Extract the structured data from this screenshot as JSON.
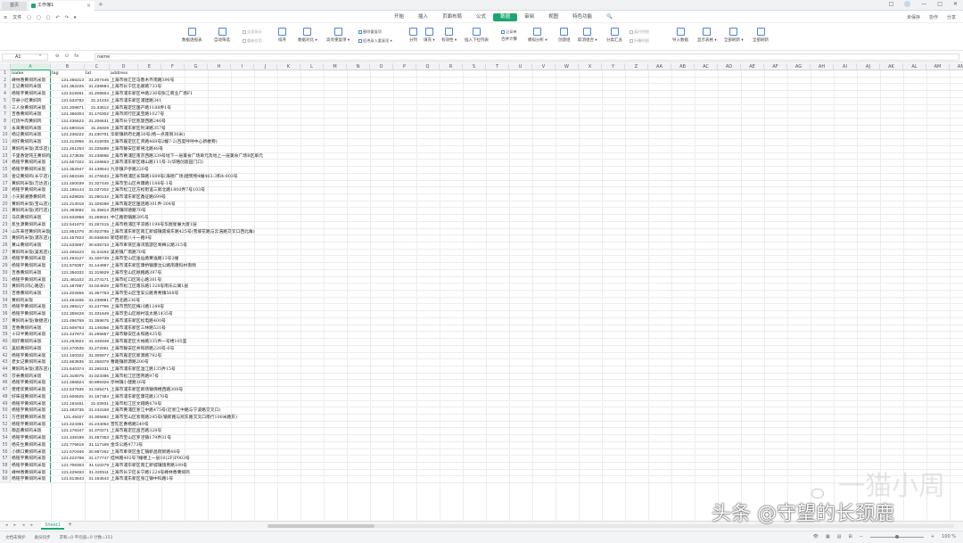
{
  "titlebar": {
    "home_tab": "首页",
    "doc_tab": "工作簿1",
    "add_tab": "+",
    "win_controls": [
      "□",
      "—",
      "□",
      "✕"
    ]
  },
  "menubar": {
    "file": "文件",
    "quick_icons": [
      "▢",
      "▢",
      "▢",
      "↶",
      "↷",
      "▾"
    ],
    "tabs": [
      "开始",
      "插入",
      "页面布局",
      "公式",
      "数据",
      "审阅",
      "视图",
      "特色功能"
    ],
    "active_tab": "数据",
    "search": "🔍",
    "right_items": [
      "未保存",
      "协作",
      "分享"
    ]
  },
  "ribbon": {
    "buttons": [
      {
        "label": "数据透视表"
      },
      {
        "label": "自动筛选"
      },
      {
        "label": "排序"
      },
      {
        "label": "数据对比 ▾"
      },
      {
        "label": "高亮重复项 ▾"
      },
      {
        "label": "分列"
      },
      {
        "label": "填充 ▾"
      },
      {
        "label": "有效性 ▾"
      },
      {
        "label": "插入下拉列表"
      },
      {
        "label": "合并计算"
      },
      {
        "label": "模拟分析 ▾"
      },
      {
        "label": "创建组"
      },
      {
        "label": "取消组合 ▾"
      },
      {
        "label": "分类汇总"
      },
      {
        "label": "导入数据"
      },
      {
        "label": "显示表格 ▾"
      },
      {
        "label": "全部刷新 ▾"
      },
      {
        "label": "全部刷新"
      }
    ],
    "small_items": {
      "all_show": "全部显示",
      "reapply": "重新应用",
      "delete_dup": "删除重复项",
      "reject_dup": "拒绝录入重复项 ▾",
      "record_sheet": "记录单",
      "expand_detail": "展开明细",
      "collapse_detail": "折叠明细"
    }
  },
  "formulabar": {
    "cell_ref": "A1",
    "icons": [
      "⊖",
      "⊙",
      "fx"
    ],
    "content": "name"
  },
  "columns": [
    "A",
    "B",
    "C",
    "D",
    "E",
    "F",
    "G",
    "H",
    "I",
    "J",
    "K",
    "L",
    "M",
    "N",
    "O",
    "P",
    "Q",
    "R",
    "S",
    "T",
    "U",
    "V",
    "W",
    "X",
    "Y",
    "Z",
    "AA",
    "AB",
    "AC",
    "AD",
    "AE",
    "AF",
    "AG",
    "AH",
    "AI",
    "AJ",
    "AK",
    "AL",
    "AM",
    "AN"
  ],
  "header_row": {
    "name": "name",
    "lng": "lng",
    "lat": "lat",
    "address": "address"
  },
  "rows": [
    [
      "嵊林香黄焖鸡米饭",
      "121.456313",
      "31.207446",
      "上海市徐汇区乌鲁木齐南路396号"
    ],
    [
      "王记黄焖鸡米饭",
      "121.352225",
      "31.238684",
      "上海市长宁区北翟路733号"
    ],
    [
      "杨铭宇黄焖鸡米饭",
      "121.619461",
      "31.208504",
      "上海市浦东新区中路236号张江商业广场F1"
    ],
    [
      "莎县小吃黄焖鸡",
      "121.533782",
      "31.21432",
      "上海市浦东新区浦建路341"
    ],
    [
      "三人食黄焖鸡米饭",
      "121.208871",
      "31.33612",
      "上海市嘉定区国产路1188弄1号"
    ],
    [
      "吉香黄焖鸡米饭",
      "121.366304",
      "31.176302",
      "上海市闵行区吴宝路1027号"
    ],
    [
      "红烧牛肉黄焖鸡",
      "121.436622",
      "31.206631",
      "上海市长宁区凯旋西路246号"
    ],
    [
      "永来黄焖鸡米饭",
      "121.590318",
      "31.28329",
      "上海市浦东新区利津路357号"
    ],
    [
      "杨记黄焖鸡米饭",
      "121.236222",
      "31.230701",
      "华新镇新府北路30号(杨一点南侧30米)"
    ],
    [
      "闹仔黄焖鸡米饭",
      "121.212966",
      "31.419039",
      "上海市嘉定区汇贤路468号2幢7-2(百度呼呼中心新楼旁)"
    ],
    [
      "黄焖鸡米饭(高华店)",
      "121.461253",
      "31.225688",
      "上海市静安区新闸北路48号"
    ],
    [
      "千里香馄饨王黄焖鸡",
      "121.473635",
      "31.238895",
      "上海市黄浦区南京西路339号地下一层美食广场单元及地上一层美食广场B区单元"
    ],
    [
      "杨铭宇黄焖鸡米饭",
      "121.557322",
      "31.228663",
      "上海市浦东新区峨山路111号-3(华略创意园门口)"
    ],
    [
      "杨铭宇黄焖鸡米饭",
      "121.352947",
      "31.138544",
      "九亭镇沪亭路220号"
    ],
    [
      "壹记黄焖鸡(长宁店)",
      "121.582346",
      "31.276633",
      "上海市杨浦区长阳路1689号(海德广场)建筑物4幢403-3和4-003号"
    ],
    [
      "黄焖鸡米饭(万达店)",
      "121.450039",
      "31.327445",
      "上海市宝山区共康路1188号-1号"
    ],
    [
      "杨铭宇黄焖鸡米饭",
      "121.195144",
      "31.037202",
      "上海市松江区方松街道三新北路1800弄7号103号"
    ],
    [
      "小天鹅湘香黄焖鸡",
      "121.628825",
      "31.290132",
      "上海市浦东新区鑫征路699号"
    ],
    [
      "黄焖鸡米饭(宝山店)",
      "121.213018",
      "31.329288",
      "上海市嘉定区国店路301弄-304号"
    ],
    [
      "黄焖鸡米饭(闵行店)",
      "121.383882",
      "31.35813",
      "高桥镇同德路70号"
    ],
    [
      "马氏黄焖鸡米饭",
      "121.632958",
      "31.259021",
      "中江路街镇路395号"
    ],
    [
      "凯生源黄焖鸡米饭",
      "121.541873",
      "31.267415",
      "上海市杨浦区平凉路1198号华宸星展大厦1层"
    ],
    [
      "山东来佳黄焖鸡米饭",
      "121.951076",
      "30.923795",
      "上海市浦东新区南汇新城镇雷坡东路425号(雪坡花路与云浩路交叉口西北角)"
    ],
    [
      "黄焖鸡米饭(浦东店)",
      "121.457823",
      "30.836846",
      "新塔新街八十一路9号"
    ],
    [
      "黄山黄焖鸡米饭",
      "121.533697",
      "30.835733",
      "上海市奉贤区海湾旅游区奉梅公路315号"
    ],
    [
      "黄焖鸡米饭(吴淞店)",
      "121.465423",
      "31.04192",
      "吴淞镇广南路70号"
    ],
    [
      "杨铭宇黄焖鸡米饭",
      "121.493127",
      "31.326739",
      "上海市宝山区逸仙路黄逸路13号2幢"
    ],
    [
      "杨铭宇黄焖鸡米饭",
      "121.578367",
      "31.144987",
      "上海市浦东新区康桥镇康沈公路南康科村南侧"
    ],
    [
      "吉香黄焖鸡米饭",
      "121.356332",
      "31.319829",
      "上海市宝山区顾路路397号"
    ],
    [
      "杨铭宇黄焖鸡米饭",
      "121.481102",
      "31.274171",
      "上海市虹口区同心路381号"
    ],
    [
      "黄焖鸡(同心路店)",
      "121.287897",
      "31.024826",
      "上海市松江区南乐路1328号南乐公寓1层"
    ],
    [
      "吉香黄焖鸡米饭",
      "121.402655",
      "31.367753",
      "上海市宝山区宝安公路青秀镇568号"
    ],
    [
      "黄焖鸡米饭",
      "121.484465",
      "31.238981",
      "广西北路236号"
    ],
    [
      "杨铭宇黄焖鸡米饭",
      "121.399217",
      "31.247796",
      "上海市普陀区梅川路1249号"
    ],
    [
      "杨铭宇黄焖鸡米饭",
      "121.359429",
      "31.331949",
      "上海市宝山区顾村莲太路1435号"
    ],
    [
      "黄焖鸡米饭(敏捷店)",
      "121.496769",
      "31.359675",
      "上海市浦东新区松电路400号"
    ],
    [
      "吉香黄焖鸡米饭",
      "121.508763",
      "31.149356",
      "上海市浦东新区三林路531号"
    ],
    [
      "十日半黄焖鸡米饭",
      "121.447873",
      "31.295857",
      "上海市静安区永和路425号"
    ],
    [
      "闹仔黄焖鸡米饭",
      "121.264922",
      "31.349349",
      "上海市嘉定区大裕路335弄一号楼105室"
    ],
    [
      "吴妈黄焖鸡米饭",
      "121.470535",
      "31.272061",
      "上海市静安区共和新路220号-6号"
    ],
    [
      "杨铭宇黄焖鸡米饭",
      "121.160322",
      "31.305977",
      "上海市嘉定区新源路792号"
    ],
    [
      "老女记黄焖鸡米饭",
      "121.663835",
      "31.268379",
      "曹路镇新源路200号"
    ],
    [
      "黄焖鸡米饭(浦东店)",
      "121.640374",
      "31.265331",
      "上海市浦东新区温江路135弄15号"
    ],
    [
      "莎县黄焖鸡米饭",
      "121.318075",
      "31.023395",
      "上海市松江区团青路97号"
    ],
    [
      "杨铭宇黄焖鸡米饭",
      "121.286824",
      "30.899326",
      "亭林镇小建路16号"
    ],
    [
      "佬佬欢黄焖鸡米饭",
      "121.647835",
      "31.025471",
      "上海市浦东新区新场镇佛楼西路308号"
    ],
    [
      "好味道黄焖鸡米饭",
      "121.606825",
      "31.197384",
      "上海市浦东新区康花路1370号"
    ],
    [
      "杨铭宇黄焖鸡米饭",
      "121.193451",
      "31.03931",
      "上海市松江区文翔路478号"
    ],
    [
      "杨铭宇黄焖鸡米饭",
      "121.483735",
      "31.243168",
      "上海市黄浦区浙江中路475号(近浙江中路与宁波路交叉口)"
    ],
    [
      "方佳厨黄焖鸡米饭",
      "121.45027",
      "31.305682",
      "上海市宝山区淞南路245号(镇新路与淞东路交叉口南行100米路东)"
    ],
    [
      "杨铭宇黄焖鸡米饭",
      "121.424361",
      "31.244062",
      "普陀区曹杨路549号"
    ],
    [
      "御品黄焖鸡米饭",
      "121.178347",
      "31.370271",
      "上海市嘉定区昌吉路328号"
    ],
    [
      "杨铭宇黄焖鸡米饭",
      "121.349199",
      "31.487353",
      "上海市宝山区罗泾镇179弄31号"
    ],
    [
      "杨先生黄焖鸡米饭",
      "121.776619",
      "31.117199",
      "金华公路4773号"
    ],
    [
      "小俩口黄焖鸡米饭",
      "121.570466",
      "30.987262",
      "上海市奉贤区金汇镇新昌街新路48号"
    ],
    [
      "杨铭宇黄焖鸡米饭",
      "121.422768",
      "31.177747",
      "桂林路402号7幢楼上一层10(2F)P003号"
    ],
    [
      "杨铭宇黄焖鸡米饭",
      "121.706303",
      "31.110279",
      "上海市浦东新区南汇新城镇镜青路189号"
    ],
    [
      "嵊林香黄焖鸡米饭",
      "121.429463",
      "31.220511",
      "上海市长宁区长宁路1224号嵊林香黄焖鸡"
    ],
    [
      "杨铭宇黄焖鸡米饭",
      "121.613643",
      "31.163542",
      "上海市浦东新区张江镇中科路1号"
    ]
  ],
  "sheetbar": {
    "nav": [
      "◂",
      "▸",
      "◂",
      "▸"
    ],
    "sheet_name": "Sheet1",
    "add_sheet": "+"
  },
  "statusbar": {
    "left": [
      "文档未保护",
      "备份同步"
    ],
    "stats": "求和=0  平均值=0  计数=151",
    "right_icons": [
      "👁",
      "▦",
      "▤",
      "⊞"
    ],
    "zoom_minus": "−",
    "zoom_plus": "+",
    "zoom": "100 %"
  },
  "watermark": {
    "text": "头条 @守望的长颈鹿",
    "bg_text": "一猫小周"
  }
}
